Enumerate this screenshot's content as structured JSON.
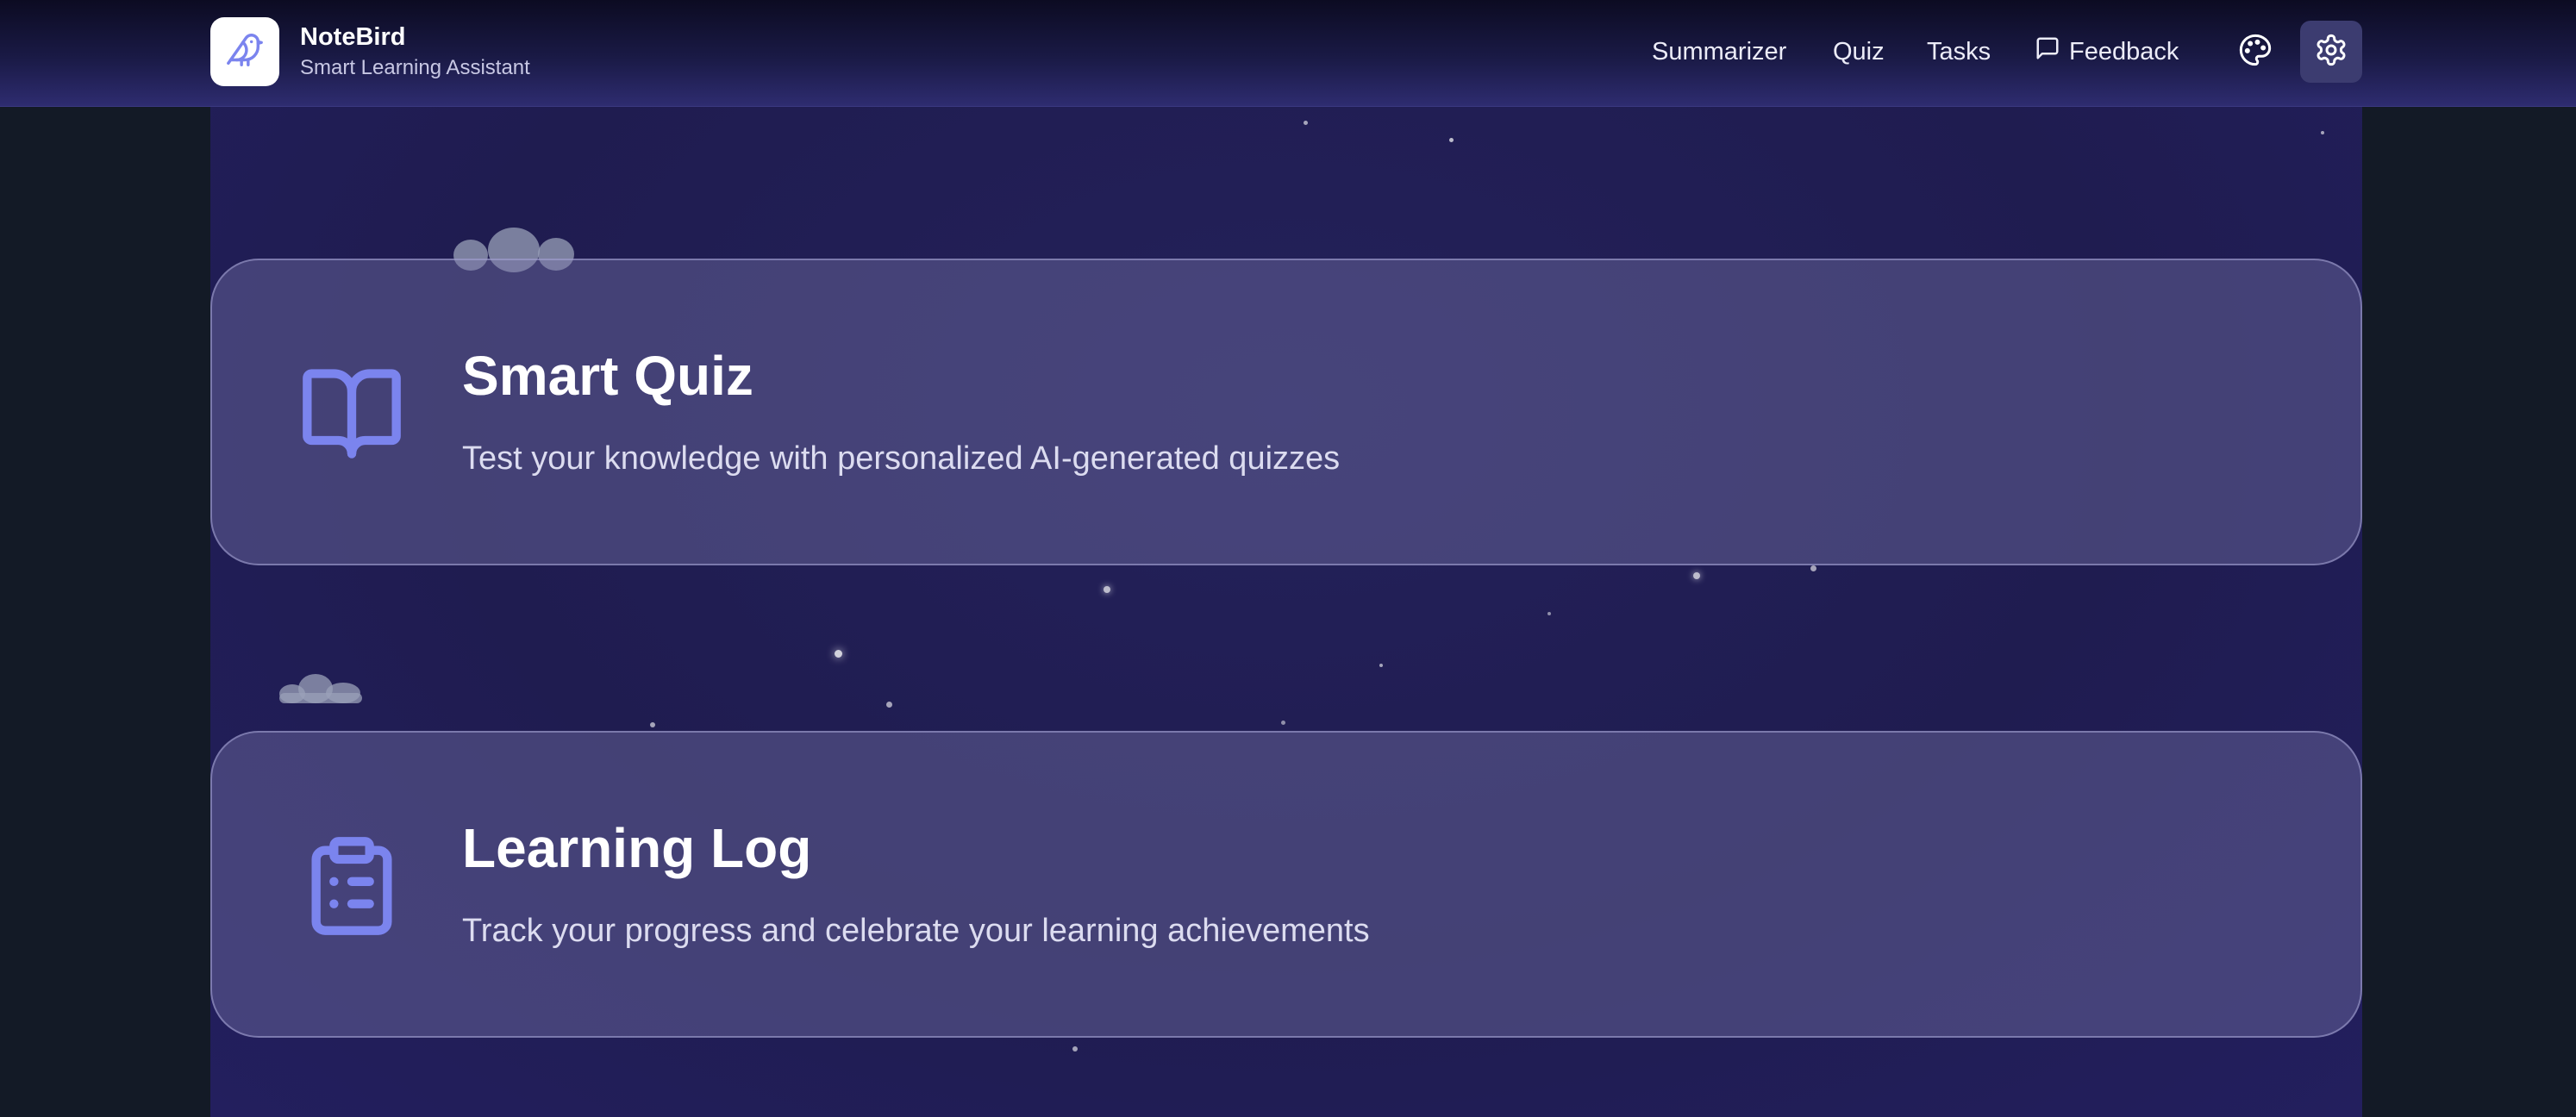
{
  "app": {
    "name": "NoteBird",
    "tagline": "Smart Learning Assistant",
    "logo_icon": "bird-icon"
  },
  "nav": {
    "items": [
      {
        "label": "Summarizer"
      },
      {
        "label": "Quiz"
      },
      {
        "label": "Tasks"
      },
      {
        "label": "Feedback",
        "icon": "message-square-icon"
      }
    ],
    "theme_icon": "palette-icon",
    "settings_icon": "gear-icon"
  },
  "cards": [
    {
      "title": "Smart Quiz",
      "description": "Test your knowledge with personalized AI-generated quizzes",
      "icon": "book-open-icon"
    },
    {
      "title": "Learning Log",
      "description": "Track your progress and celebrate your learning achievements",
      "icon": "clipboard-list-icon"
    }
  ],
  "colors": {
    "accent": "#7b84ee",
    "header_bg": "#1a1a46",
    "main_bg": "#221f58",
    "outer_bg": "#131a26"
  }
}
